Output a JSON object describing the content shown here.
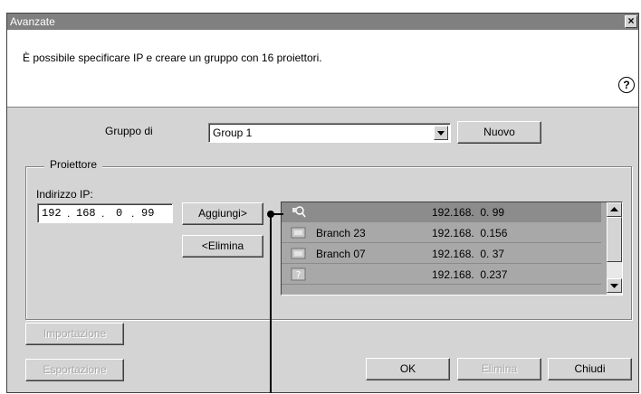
{
  "window": {
    "title": "Avanzate",
    "close_label": "×"
  },
  "description": "È possibile specificare IP e creare un gruppo con 16 proiettori.",
  "help_label": "?",
  "group": {
    "label": "Gruppo di",
    "value": "Group 1",
    "new_button": "Nuovo"
  },
  "projector": {
    "section_label": "Proiettore",
    "ip_label": "Indirizzo IP:",
    "ip_octets": [
      "192",
      "168",
      "0",
      "99"
    ],
    "add_button": "Aggiungi>",
    "remove_button": "<Elimina",
    "list": [
      {
        "name": "",
        "ip": "192.168.  0. 99",
        "icon": "search-projector-icon",
        "selected": true
      },
      {
        "name": "Branch 23",
        "ip": "192.168.  0.156",
        "icon": "projector-icon",
        "selected": false
      },
      {
        "name": "Branch 07",
        "ip": "192.168.  0. 37",
        "icon": "projector-icon",
        "selected": false
      },
      {
        "name": "",
        "ip": "192.168.  0.237",
        "icon": "unknown-projector-icon",
        "selected": false
      }
    ]
  },
  "buttons": {
    "import": "Importazione",
    "export": "Esportazione",
    "ok": "OK",
    "delete": "Elimina",
    "close": "Chiudi"
  }
}
